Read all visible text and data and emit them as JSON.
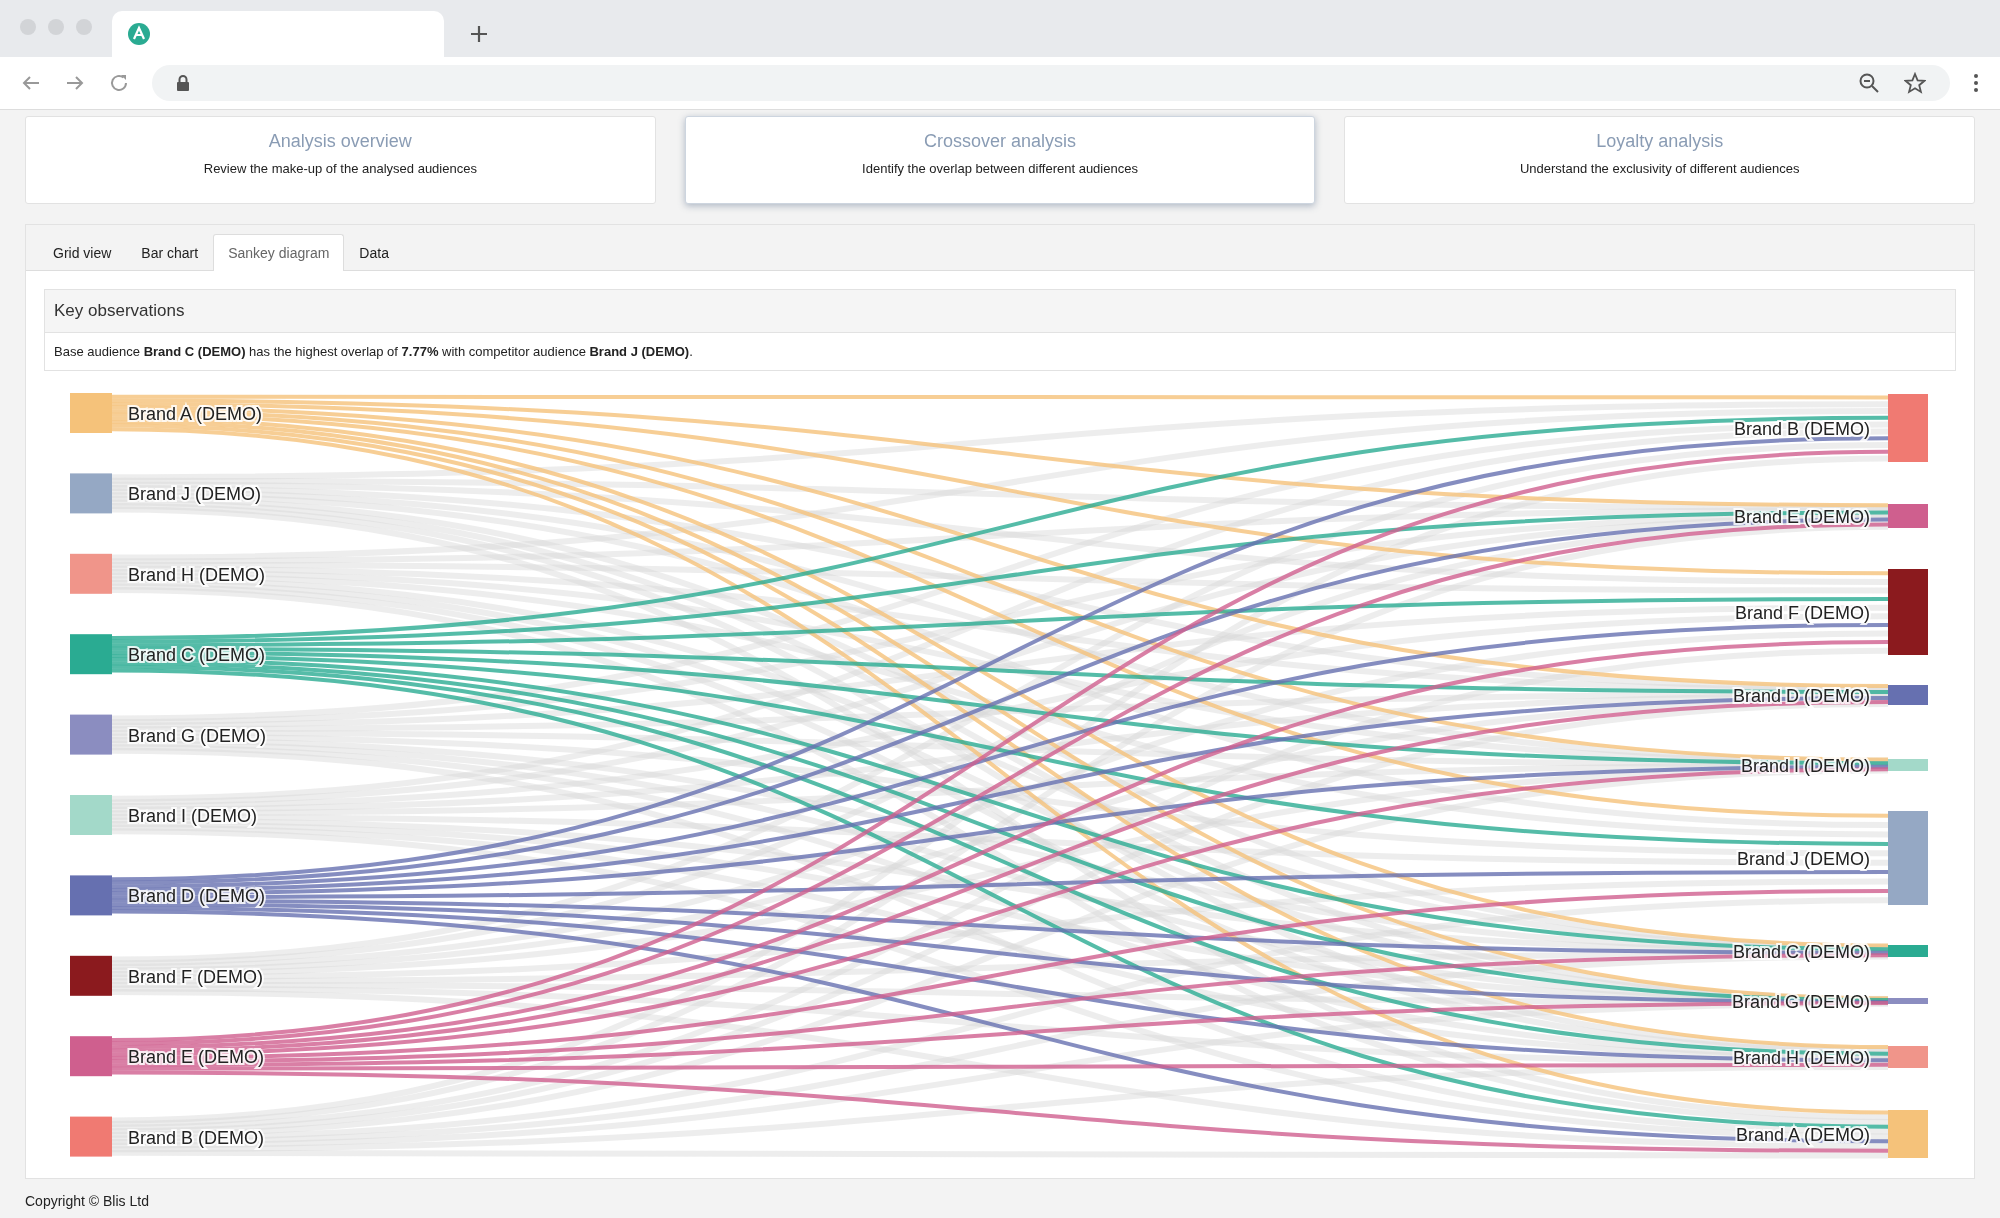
{
  "nav_cards": [
    {
      "title": "Analysis overview",
      "description": "Review the make-up of the analysed audiences",
      "selected": false
    },
    {
      "title": "Crossover analysis",
      "description": "Identify the overlap between different audiences",
      "selected": true
    },
    {
      "title": "Loyalty analysis",
      "description": "Understand the exclusivity of different audiences",
      "selected": false
    }
  ],
  "tabs": [
    {
      "label": "Grid view",
      "selected": false
    },
    {
      "label": "Bar chart",
      "selected": false
    },
    {
      "label": "Sankey diagram",
      "selected": true
    },
    {
      "label": "Data",
      "selected": false
    }
  ],
  "observations": {
    "title": "Key observations",
    "text": "Base audience **Brand C (DEMO)** has the highest overlap of **7.77%** with competitor audience **Brand J (DEMO)**."
  },
  "sankey": {
    "sources": [
      {
        "label": "Brand A (DEMO)",
        "color": "#f5c27a",
        "highlighted": true
      },
      {
        "label": "Brand J (DEMO)",
        "color": "#95a8c4",
        "highlighted": false
      },
      {
        "label": "Brand H (DEMO)",
        "color": "#f0958a",
        "highlighted": false
      },
      {
        "label": "Brand C (DEMO)",
        "color": "#2aab92",
        "highlighted": true
      },
      {
        "label": "Brand G (DEMO)",
        "color": "#8b8dc0",
        "highlighted": false
      },
      {
        "label": "Brand I (DEMO)",
        "color": "#a3d9c9",
        "highlighted": false
      },
      {
        "label": "Brand D (DEMO)",
        "color": "#6670b0",
        "highlighted": true
      },
      {
        "label": "Brand F (DEMO)",
        "color": "#8b1a1e",
        "highlighted": false
      },
      {
        "label": "Brand E (DEMO)",
        "color": "#cf5f8e",
        "highlighted": true
      },
      {
        "label": "Brand B (DEMO)",
        "color": "#f07a72",
        "highlighted": false
      }
    ],
    "targets": [
      {
        "label": "Brand B (DEMO)",
        "color": "#f07a72"
      },
      {
        "label": "Brand E (DEMO)",
        "color": "#cf5f8e"
      },
      {
        "label": "Brand F (DEMO)",
        "color": "#8b1a1e"
      },
      {
        "label": "Brand D (DEMO)",
        "color": "#6670b0"
      },
      {
        "label": "Brand I (DEMO)",
        "color": "#a3d9c9"
      },
      {
        "label": "Brand J (DEMO)",
        "color": "#95a8c4"
      },
      {
        "label": "Brand C (DEMO)",
        "color": "#2aab92"
      },
      {
        "label": "Brand G (DEMO)",
        "color": "#8b8dc0"
      },
      {
        "label": "Brand H (DEMO)",
        "color": "#f0958a"
      },
      {
        "label": "Brand A (DEMO)",
        "color": "#f5c27a"
      }
    ]
  },
  "footer": "Copyright © Blis Ltd"
}
